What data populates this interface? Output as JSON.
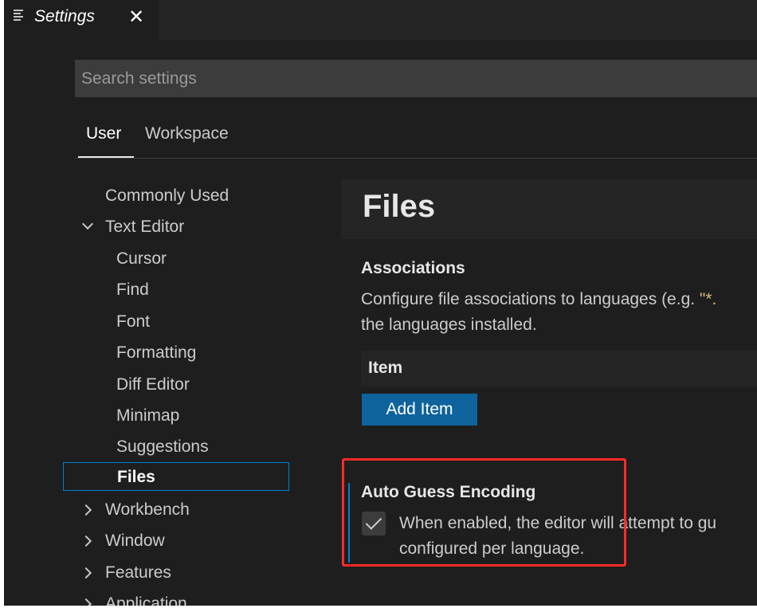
{
  "tab": {
    "title": "Settings",
    "close_glyph": "✕",
    "icon": "settings-list-icon"
  },
  "search": {
    "placeholder": "Search settings",
    "value": ""
  },
  "scope_tabs": [
    {
      "label": "User",
      "active": true
    },
    {
      "label": "Workspace",
      "active": false
    }
  ],
  "tree": {
    "commonly_used": "Commonly Used",
    "text_editor": "Text Editor",
    "text_editor_children": [
      "Cursor",
      "Find",
      "Font",
      "Formatting",
      "Diff Editor",
      "Minimap",
      "Suggestions",
      "Files"
    ],
    "workbench": "Workbench",
    "window": "Window",
    "features": "Features",
    "application": "Application"
  },
  "content": {
    "section_title": "Files",
    "associations": {
      "title": "Associations",
      "desc_prefix": "Configure file associations to languages (e.g. ",
      "desc_code": "\"*.",
      "desc_line2": "the languages installed.",
      "item_header": "Item",
      "add_button": "Add Item"
    },
    "auto_guess_encoding": {
      "title": "Auto Guess Encoding",
      "checked": true,
      "desc_line1": "When enabled, the editor will attempt to gu",
      "desc_line2": "configured per language."
    }
  },
  "colors": {
    "background": "#1e1e1e",
    "accent": "#007fd4",
    "button": "#0e639c",
    "annotation": "#ff2a2a"
  }
}
